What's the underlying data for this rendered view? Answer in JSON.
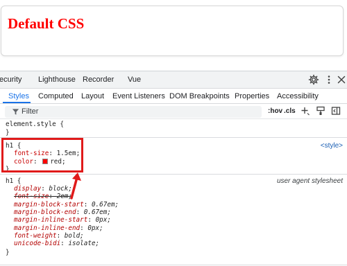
{
  "page": {
    "heading": "Default CSS",
    "heading_color": "#ff0000"
  },
  "devtools": {
    "top_tabs": [
      "ecurity",
      "Lighthouse",
      "Recorder",
      "Vue"
    ],
    "top_icons": [
      "gear-icon",
      "kebab-menu-icon",
      "close-icon"
    ],
    "sub_tabs": [
      "Styles",
      "Computed",
      "Layout",
      "Event Listeners",
      "DOM Breakpoints",
      "Properties",
      "Accessibility"
    ],
    "active_sub_tab": "Styles",
    "filter": {
      "placeholder": "Filter",
      "hov": ":hov",
      "cls": ".cls"
    },
    "rules": {
      "element_style": {
        "selector": "element.style {",
        "close": "}"
      },
      "author_h1": {
        "selector": "h1 {",
        "source": "<style>",
        "font_size_prop": "font-size",
        "font_size_val": "1.5em;",
        "color_prop": "color",
        "color_val": "red;",
        "swatch_color": "#ff0000",
        "close": "}"
      },
      "ua_h1": {
        "selector": "h1 {",
        "source": "user agent stylesheet",
        "declarations": [
          {
            "prop": "display",
            "val": "block;",
            "overridden": false
          },
          {
            "prop": "font-size",
            "val": "2em;",
            "overridden": true
          },
          {
            "prop": "margin-block-start",
            "val": "0.67em;",
            "overridden": false
          },
          {
            "prop": "margin-block-end",
            "val": "0.67em;",
            "overridden": false
          },
          {
            "prop": "margin-inline-start",
            "val": "0px;",
            "overridden": false
          },
          {
            "prop": "margin-inline-end",
            "val": "0px;",
            "overridden": false
          },
          {
            "prop": "font-weight",
            "val": "bold;",
            "overridden": false
          },
          {
            "prop": "unicode-bidi",
            "val": "isolate;",
            "overridden": false
          }
        ],
        "close": "}"
      }
    },
    "annotation_color": "#e01a1a"
  }
}
